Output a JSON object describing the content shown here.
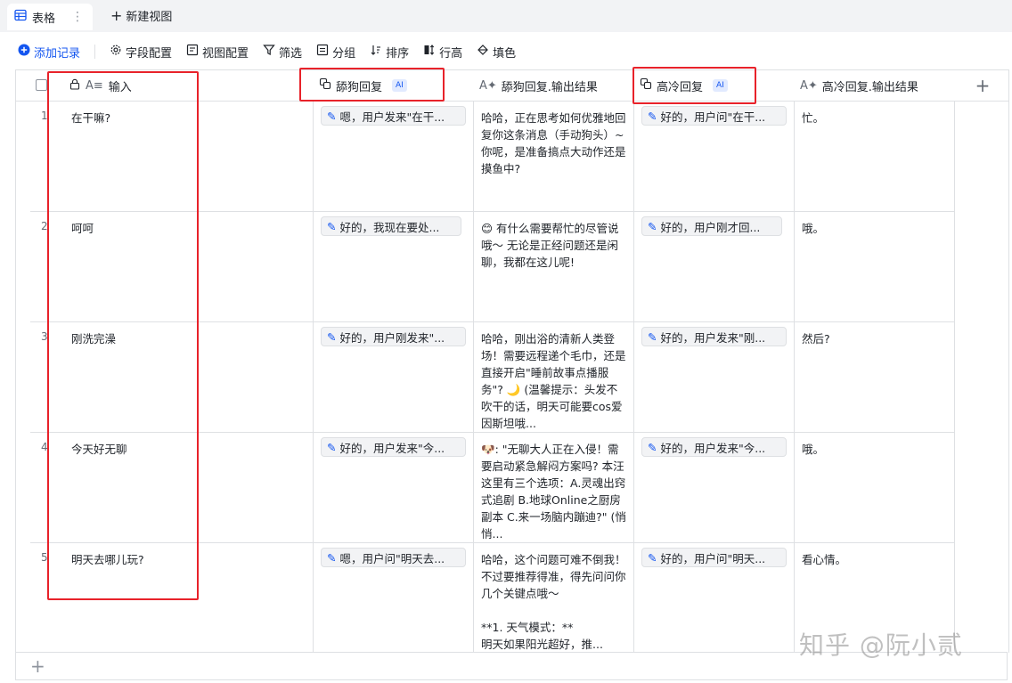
{
  "tabs": {
    "active_label": "表格",
    "more": "⋮",
    "new_view": "新建视图"
  },
  "toolbar": {
    "add_record": "添加记录",
    "field_config": "字段配置",
    "view_config": "视图配置",
    "filter": "筛选",
    "group": "分组",
    "sort": "排序",
    "row_height": "行高",
    "fill_color": "填色"
  },
  "columns": {
    "input": "输入",
    "lick": "舔狗回复",
    "lick_out": "舔狗回复.输出结果",
    "cold": "高冷回复",
    "cold_out": "高冷回复.输出结果",
    "ai_tag": "AI",
    "add_col": "+"
  },
  "rows": [
    {
      "num": "1",
      "input": "在干嘛?",
      "lick_pill": "嗯，用户发来\"在干...",
      "lick_out": "哈哈，正在思考如何优雅地回复你这条消息（手动狗头）~你呢，是准备搞点大动作还是摸鱼中?",
      "cold_pill": "好的，用户问\"在干...",
      "cold_out": "忙。"
    },
    {
      "num": "2",
      "input": "呵呵",
      "lick_pill": "好的，我现在要处...",
      "lick_out": "😊 有什么需要帮忙的尽管说哦～ 无论是正经问题还是闲聊，我都在这儿呢!",
      "cold_pill": "好的，用户刚才回...",
      "cold_out": "哦。"
    },
    {
      "num": "3",
      "input": "刚洗完澡",
      "lick_pill": "好的，用户刚发来\"...",
      "lick_out": "哈哈，刚出浴的清新人类登场！需要远程递个毛巾，还是直接开启\"睡前故事点播服务\"? 🌙 (温馨提示：头发不吹干的话，明天可能要cos爱因斯坦哦...",
      "cold_pill": "好的，用户发来\"刚...",
      "cold_out": "然后?"
    },
    {
      "num": "4",
      "input": "今天好无聊",
      "lick_pill": "好的，用户发来\"今...",
      "lick_out": "🐶: \"无聊大人正在入侵！需要启动紧急解闷方案吗? 本汪这里有三个选项：A.灵魂出窍式追剧 B.地球Online之厨房副本 C.来一场脑内蹦迪?\" (悄悄...",
      "cold_pill": "好的，用户发来\"今...",
      "cold_out": "哦。"
    },
    {
      "num": "5",
      "input": "明天去哪儿玩?",
      "lick_pill": "嗯，用户问\"明天去...",
      "lick_out": "哈哈，这个问题可难不倒我！不过要推荐得准，得先问问你几个关键点哦～\n\n**1. 天气模式：**\n明天如果阳光超好，推...",
      "cold_pill": "好的，用户问\"明天...",
      "cold_out": "看心情。"
    }
  ],
  "footer": {
    "add_row": "+"
  },
  "watermark": "知乎 @阮小贰",
  "accent_color": "#1456f0",
  "annotation_color": "#e8222a"
}
